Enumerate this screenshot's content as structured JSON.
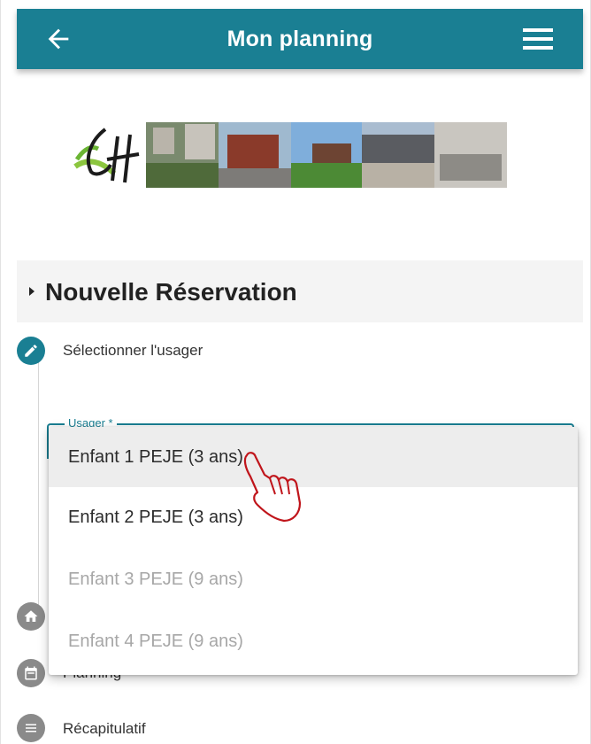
{
  "header": {
    "title": "Mon planning",
    "back_icon": "arrow-left-icon",
    "menu_icon": "hamburger-menu-icon"
  },
  "banner": {
    "logo_text": "CH"
  },
  "section": {
    "title": "Nouvelle Réservation"
  },
  "steps": [
    {
      "label": "Sélectionner l'usager",
      "icon": "pencil-icon",
      "active": true
    },
    {
      "label": "",
      "icon": "home-icon",
      "active": false
    },
    {
      "label": "Planning",
      "icon": "calendar-icon",
      "active": false
    },
    {
      "label": "Récapitulatif",
      "icon": "list-icon",
      "active": false
    }
  ],
  "usager_field": {
    "label": "Usager *"
  },
  "dropdown": {
    "options": [
      {
        "label": "Enfant 1 PEJE (3 ans)",
        "enabled": true,
        "highlighted": true
      },
      {
        "label": "Enfant 2 PEJE (3 ans)",
        "enabled": true,
        "highlighted": false
      },
      {
        "label": "Enfant 3 PEJE (9 ans)",
        "enabled": false,
        "highlighted": false
      },
      {
        "label": "Enfant 4 PEJE (9 ans)",
        "enabled": false,
        "highlighted": false
      }
    ]
  },
  "colors": {
    "primary": "#1a7f93",
    "disabled_text": "#a7a7a7",
    "hand_cursor": "#c0151b"
  }
}
